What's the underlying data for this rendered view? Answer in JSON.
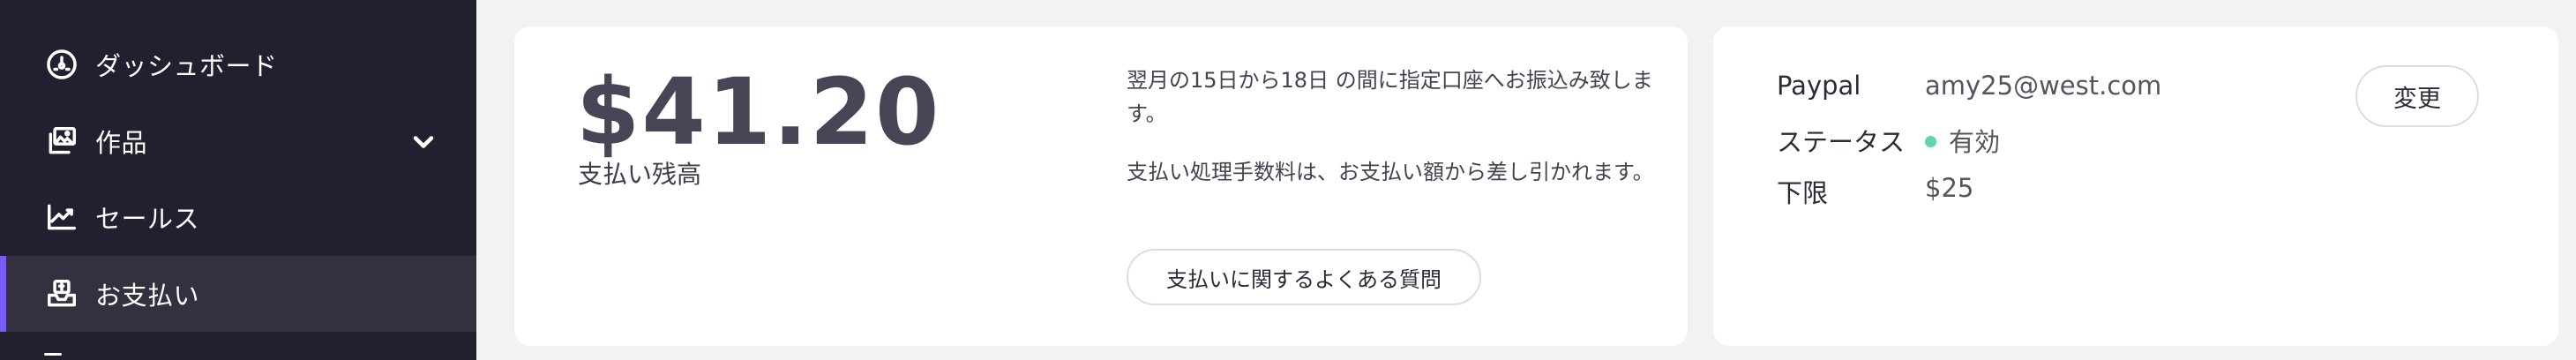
{
  "sidebar": {
    "items": [
      {
        "label": "ダッシュボード",
        "icon": "dashboard-gauge-icon"
      },
      {
        "label": "作品",
        "icon": "artwork-images-icon",
        "expand_icon": "chevron-down-icon"
      },
      {
        "label": "セールス",
        "icon": "sales-chart-icon"
      },
      {
        "label": "お支払い",
        "icon": "payment-tray-icon",
        "active": true
      }
    ],
    "accent_color": "#7a5af8",
    "background_color": "#22202f"
  },
  "balance": {
    "amount": "$41.20",
    "label": "支払い残高",
    "note_schedule": "翌月の15日から18日 の間に指定口座へお振込み致します。",
    "note_fee": "支払い処理手数料は、お支払い額から差し引かれます。",
    "faq_button": "支払いに関するよくある質問"
  },
  "account": {
    "method_label": "Paypal",
    "method_value": "amy25@west.com",
    "status_label": "ステータス",
    "status_value": "有効",
    "status_color": "#5fd6a3",
    "minimum_label": "下限",
    "minimum_value": "$25",
    "change_button": "変更"
  }
}
